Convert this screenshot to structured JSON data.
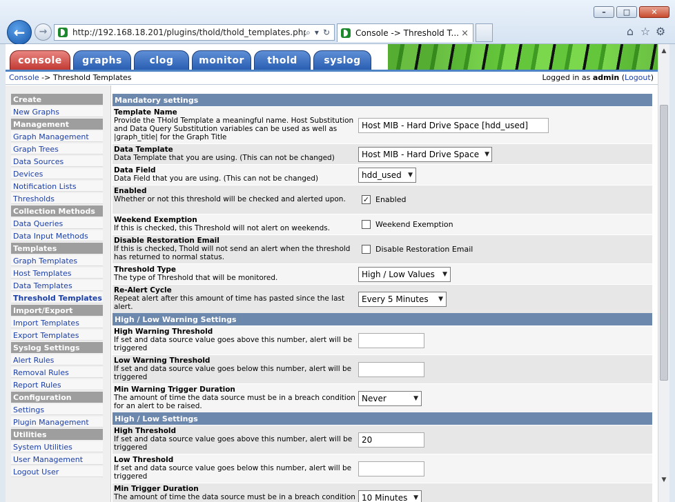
{
  "browser": {
    "url": "http://192.168.18.201/plugins/thold/thold_templates.php",
    "tab_title": "Console -> Threshold T...",
    "tab_close": "×"
  },
  "nav_tabs": [
    "console",
    "graphs",
    "clog",
    "monitor",
    "thold",
    "syslog"
  ],
  "breadcrumb": {
    "console": "Console",
    "separator": " -> ",
    "current": "Threshold Templates"
  },
  "login": {
    "prefix": "Logged in as ",
    "user": "admin",
    "open": " (",
    "logout": "Logout",
    "close": ")"
  },
  "sidebar": [
    {
      "head": "Create",
      "items": [
        "New Graphs"
      ]
    },
    {
      "head": "Management",
      "items": [
        "Graph Management",
        "Graph Trees",
        "Data Sources",
        "Devices",
        "Notification Lists",
        "Thresholds"
      ]
    },
    {
      "head": "Collection Methods",
      "items": [
        "Data Queries",
        "Data Input Methods"
      ]
    },
    {
      "head": "Templates",
      "items": [
        "Graph Templates",
        "Host Templates",
        "Data Templates",
        "Threshold Templates"
      ]
    },
    {
      "head": "Import/Export",
      "items": [
        "Import Templates",
        "Export Templates"
      ]
    },
    {
      "head": "Syslog Settings",
      "items": [
        "Alert Rules",
        "Removal Rules",
        "Report Rules"
      ]
    },
    {
      "head": "Configuration",
      "items": [
        "Settings",
        "Plugin Management"
      ]
    },
    {
      "head": "Utilities",
      "items": [
        "System Utilities",
        "User Management",
        "Logout User"
      ]
    }
  ],
  "sidebar_active": "Threshold Templates",
  "sections": {
    "mandatory": "Mandatory settings",
    "warning": "High / Low Warning Settings",
    "highlow": "High / Low Settings"
  },
  "fields": {
    "template_name": {
      "title": "Template Name",
      "desc": "Provide the THold Template a meaningful name. Host Substitution and Data Query Substitution variables can be used as well as |graph_title| for the Graph Title",
      "value": "Host MIB - Hard Drive Space [hdd_used]"
    },
    "data_template": {
      "title": "Data Template",
      "desc": "Data Template that you are using. (This can not be changed)",
      "value": "Host MIB - Hard Drive Space"
    },
    "data_field": {
      "title": "Data Field",
      "desc": "Data Field that you are using. (This can not be changed)",
      "value": "hdd_used"
    },
    "enabled": {
      "title": "Enabled",
      "desc": "Whether or not this threshold will be checked and alerted upon.",
      "label": "Enabled",
      "checked": true
    },
    "weekend": {
      "title": "Weekend Exemption",
      "desc": "If this is checked, this Threshold will not alert on weekends.",
      "label": "Weekend Exemption",
      "checked": false
    },
    "restoration": {
      "title": "Disable Restoration Email",
      "desc": "If this is checked, Thold will not send an alert when the threshold has returned to normal status.",
      "label": "Disable Restoration Email",
      "checked": false
    },
    "threshold_type": {
      "title": "Threshold Type",
      "desc": "The type of Threshold that will be monitored.",
      "value": "High / Low Values"
    },
    "realert": {
      "title": "Re-Alert Cycle",
      "desc": "Repeat alert after this amount of time has pasted since the last alert.",
      "value": "Every 5 Minutes"
    },
    "high_warn": {
      "title": "High Warning Threshold",
      "desc": "If set and data source value goes above this number, alert will be triggered",
      "value": ""
    },
    "low_warn": {
      "title": "Low Warning Threshold",
      "desc": "If set and data source value goes below this number, alert will be triggered",
      "value": ""
    },
    "min_warn_dur": {
      "title": "Min Warning Trigger Duration",
      "desc": "The amount of time the data source must be in a breach condition for an alert to be raised.",
      "value": "Never"
    },
    "high": {
      "title": "High Threshold",
      "desc": "If set and data source value goes above this number, alert will be triggered",
      "value": "20"
    },
    "low": {
      "title": "Low Threshold",
      "desc": "If set and data source value goes below this number, alert will be triggered",
      "value": ""
    },
    "min_dur": {
      "title": "Min Trigger Duration",
      "desc": "The amount of time the data source must be in a breach condition for an alert to be raised.",
      "value": "10 Minutes"
    }
  },
  "icons": {
    "back": "←",
    "forward": "→",
    "search": "⌕",
    "dropdown": "▾",
    "refresh": "↻",
    "home": "⌂",
    "star": "☆",
    "gear": "⚙",
    "check": "✓",
    "minimize": "–",
    "maximize": "□",
    "close": "✕",
    "scroll_up": "▲",
    "scroll_down": "▼",
    "select_arrow": "▼"
  }
}
